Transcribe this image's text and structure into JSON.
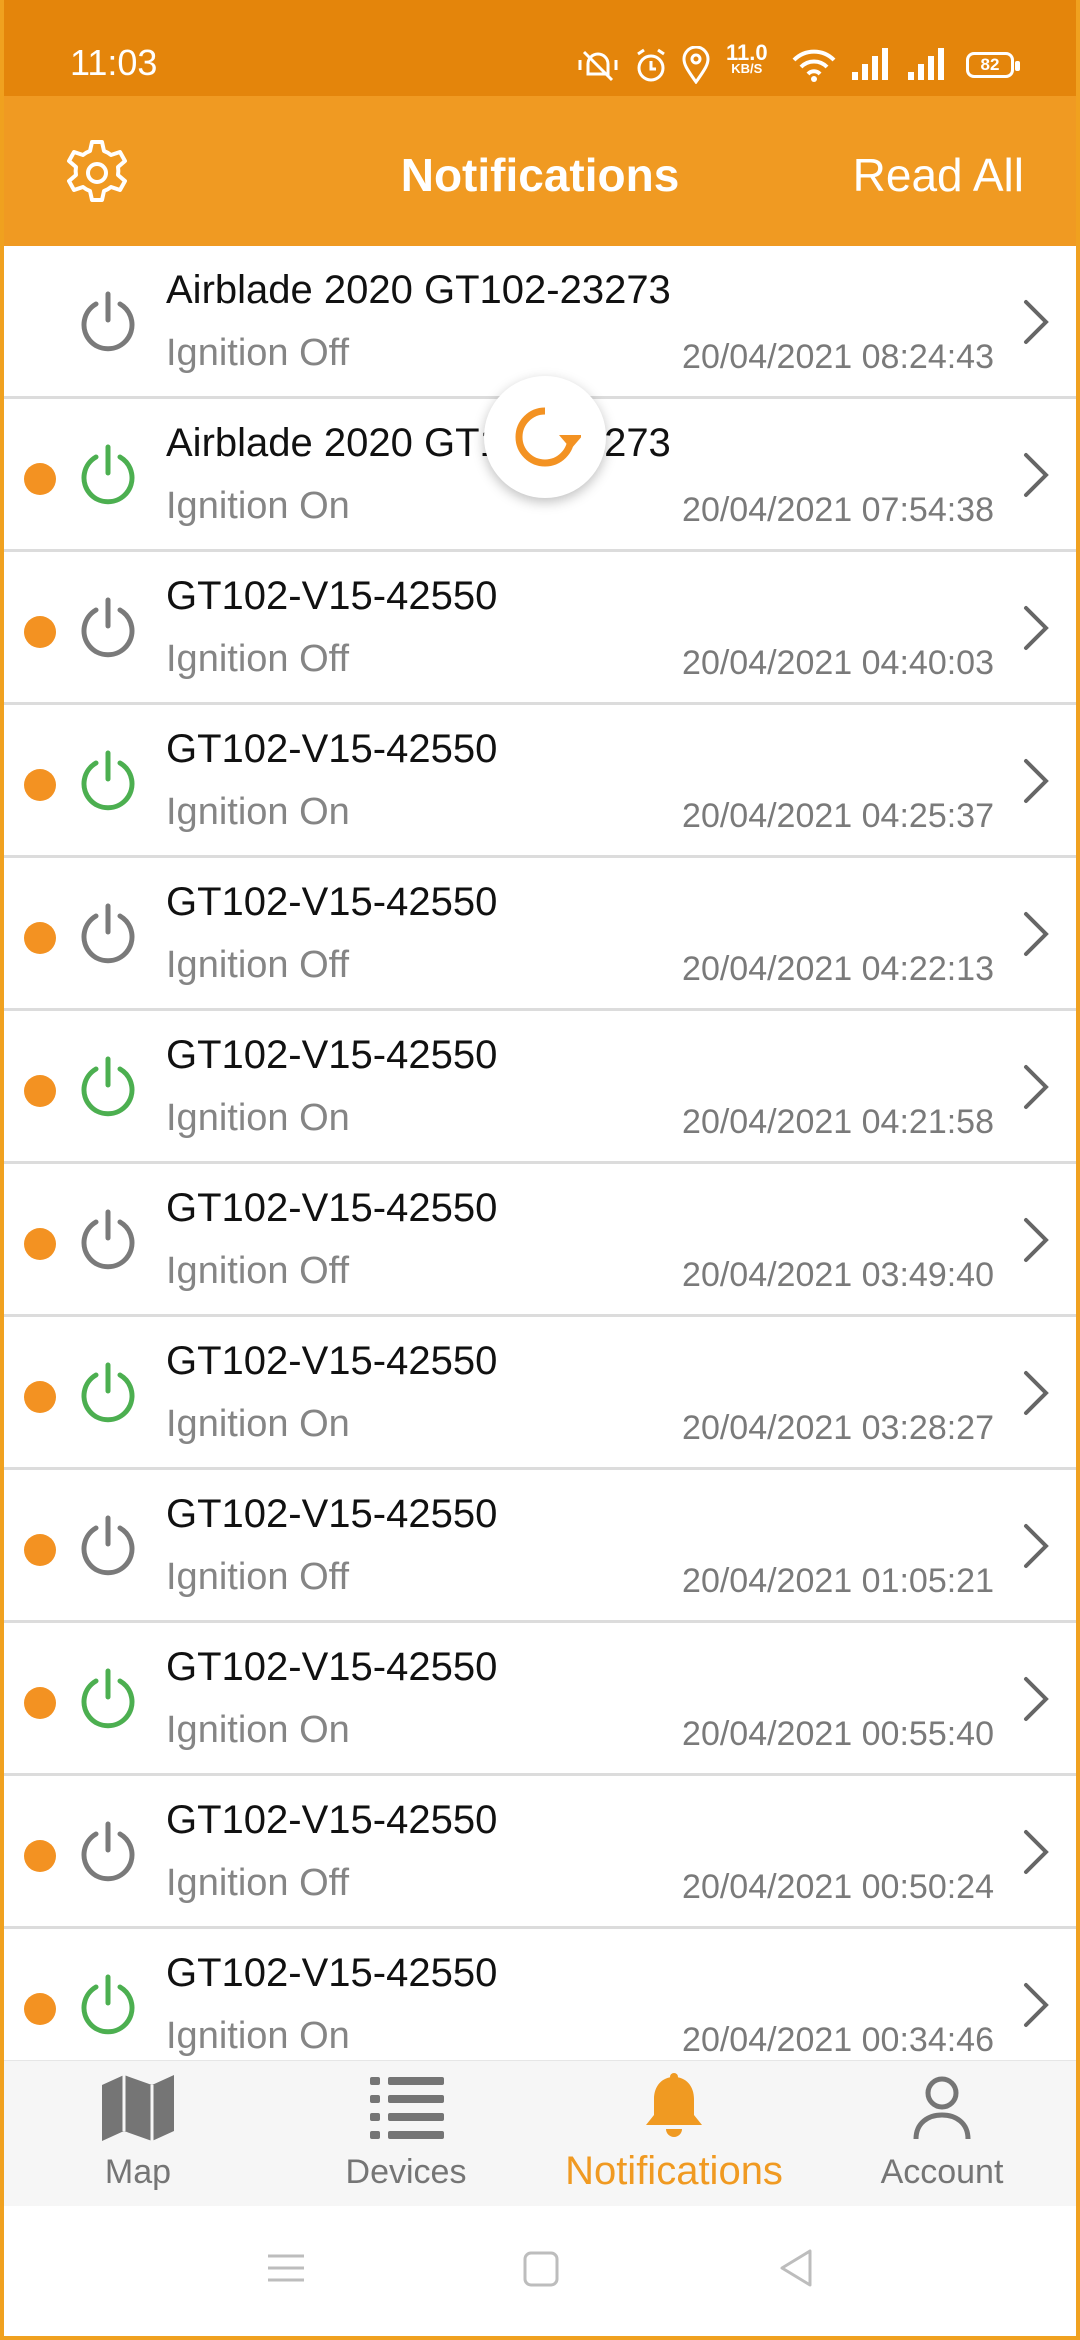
{
  "statusbar": {
    "time": "11:03",
    "net_speed_value": "11.0",
    "net_speed_unit": "KB/S",
    "battery": "82"
  },
  "header": {
    "title": "Notifications",
    "read_all": "Read All",
    "settings_icon": "gear-icon"
  },
  "notifications": [
    {
      "name": "Airblade 2020 GT102-23273",
      "status": "Ignition Off",
      "time": "20/04/2021 08:24:43",
      "unread": false,
      "state": "off"
    },
    {
      "name": "Airblade 2020 GT102-23273",
      "status": "Ignition On",
      "time": "20/04/2021 07:54:38",
      "unread": true,
      "state": "on"
    },
    {
      "name": "GT102-V15-42550",
      "status": "Ignition Off",
      "time": "20/04/2021 04:40:03",
      "unread": true,
      "state": "off"
    },
    {
      "name": "GT102-V15-42550",
      "status": "Ignition On",
      "time": "20/04/2021 04:25:37",
      "unread": true,
      "state": "on"
    },
    {
      "name": "GT102-V15-42550",
      "status": "Ignition Off",
      "time": "20/04/2021 04:22:13",
      "unread": true,
      "state": "off"
    },
    {
      "name": "GT102-V15-42550",
      "status": "Ignition On",
      "time": "20/04/2021 04:21:58",
      "unread": true,
      "state": "on"
    },
    {
      "name": "GT102-V15-42550",
      "status": "Ignition Off",
      "time": "20/04/2021 03:49:40",
      "unread": true,
      "state": "off"
    },
    {
      "name": "GT102-V15-42550",
      "status": "Ignition On",
      "time": "20/04/2021 03:28:27",
      "unread": true,
      "state": "on"
    },
    {
      "name": "GT102-V15-42550",
      "status": "Ignition Off",
      "time": "20/04/2021 01:05:21",
      "unread": true,
      "state": "off"
    },
    {
      "name": "GT102-V15-42550",
      "status": "Ignition On",
      "time": "20/04/2021 00:55:40",
      "unread": true,
      "state": "on"
    },
    {
      "name": "GT102-V15-42550",
      "status": "Ignition Off",
      "time": "20/04/2021 00:50:24",
      "unread": true,
      "state": "off"
    },
    {
      "name": "GT102-V15-42550",
      "status": "Ignition On",
      "time": "20/04/2021 00:34:46",
      "unread": true,
      "state": "on"
    }
  ],
  "bottom_nav": [
    {
      "label": "Map",
      "icon": "map-icon",
      "active": false
    },
    {
      "label": "Devices",
      "icon": "list-icon",
      "active": false
    },
    {
      "label": "Notifications",
      "icon": "bell-icon",
      "active": true
    },
    {
      "label": "Account",
      "icon": "person-icon",
      "active": false
    }
  ],
  "colors": {
    "accent": "#f09a22",
    "status_bar": "#e4850b",
    "unread_dot": "#f39222",
    "ignition_on": "#4caf50",
    "ignition_off": "#7a7a7a"
  }
}
